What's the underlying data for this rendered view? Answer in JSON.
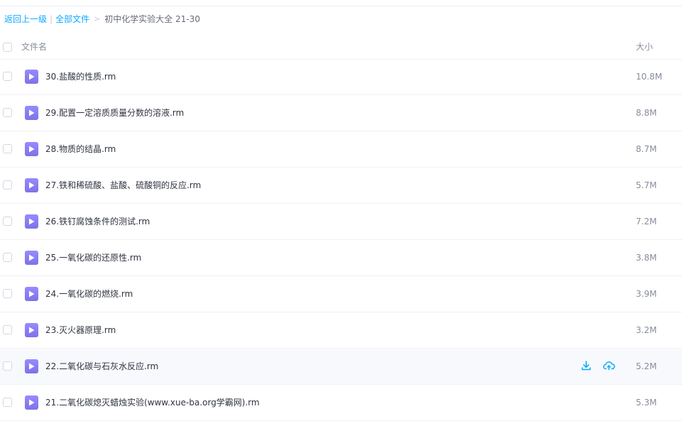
{
  "breadcrumb": {
    "back_label": "返回上一级",
    "divider": "|",
    "all_files_label": "全部文件",
    "arrow": ">",
    "current_folder": "初中化学实验大全 21-30"
  },
  "columns": {
    "name": "文件名",
    "size": "大小"
  },
  "files": [
    {
      "name": "30.盐酸的性质.rm",
      "size": "10.8M"
    },
    {
      "name": "29.配置一定溶质质量分数的溶液.rm",
      "size": "8.8M"
    },
    {
      "name": "28.物质的结晶.rm",
      "size": "8.7M"
    },
    {
      "name": "27.铁和稀硫酸、盐酸、硫酸铜的反应.rm",
      "size": "5.7M"
    },
    {
      "name": "26.铁钉腐蚀条件的测试.rm",
      "size": "7.2M"
    },
    {
      "name": "25.一氧化碳的还原性.rm",
      "size": "3.8M"
    },
    {
      "name": "24.一氧化碳的燃烧.rm",
      "size": "3.9M"
    },
    {
      "name": "23.灭火器原理.rm",
      "size": "3.2M"
    },
    {
      "name": "22.二氧化碳与石灰水反应.rm",
      "size": "5.2M"
    },
    {
      "name": "21.二氧化碳熄灭蜡烛实验(www.xue-ba.org学霸网).rm",
      "size": "5.3M"
    }
  ],
  "row_actions": {
    "download_icon": "download-icon",
    "cloud_icon": "cloud-upload-icon"
  },
  "colors": {
    "link": "#09aaff",
    "video_icon": "#8a7ff0",
    "action_icon": "#09aaff",
    "hover_row": "#f7f9fc"
  }
}
